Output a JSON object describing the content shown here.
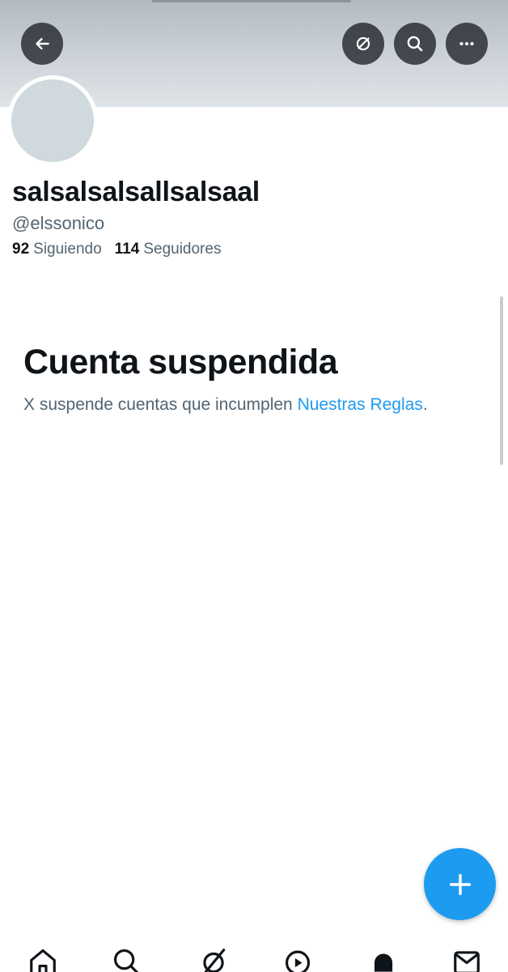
{
  "header": {
    "back_icon": "arrow-left-icon",
    "grok_icon": "grok-icon",
    "search_icon": "search-icon",
    "more_icon": "more-horizontal-icon"
  },
  "profile": {
    "display_name": "salsalsalsallsalsaal",
    "handle": "@elssonico",
    "following_count": "92",
    "following_label": "Siguiendo",
    "followers_count": "114",
    "followers_label": "Seguidores"
  },
  "suspension": {
    "title": "Cuenta suspendida",
    "text_before": "X suspende cuentas que incumplen ",
    "link_text": "Nuestras Reglas",
    "text_after": "."
  },
  "fab": {
    "icon": "plus-icon"
  },
  "bottom_nav": {
    "items": [
      {
        "icon": "home-icon"
      },
      {
        "icon": "search-icon"
      },
      {
        "icon": "grok-icon"
      },
      {
        "icon": "video-icon"
      },
      {
        "icon": "notifications-icon"
      },
      {
        "icon": "messages-icon"
      }
    ]
  },
  "colors": {
    "accent": "#1d9bf0",
    "text_primary": "#0f1419",
    "text_secondary": "#536471"
  }
}
